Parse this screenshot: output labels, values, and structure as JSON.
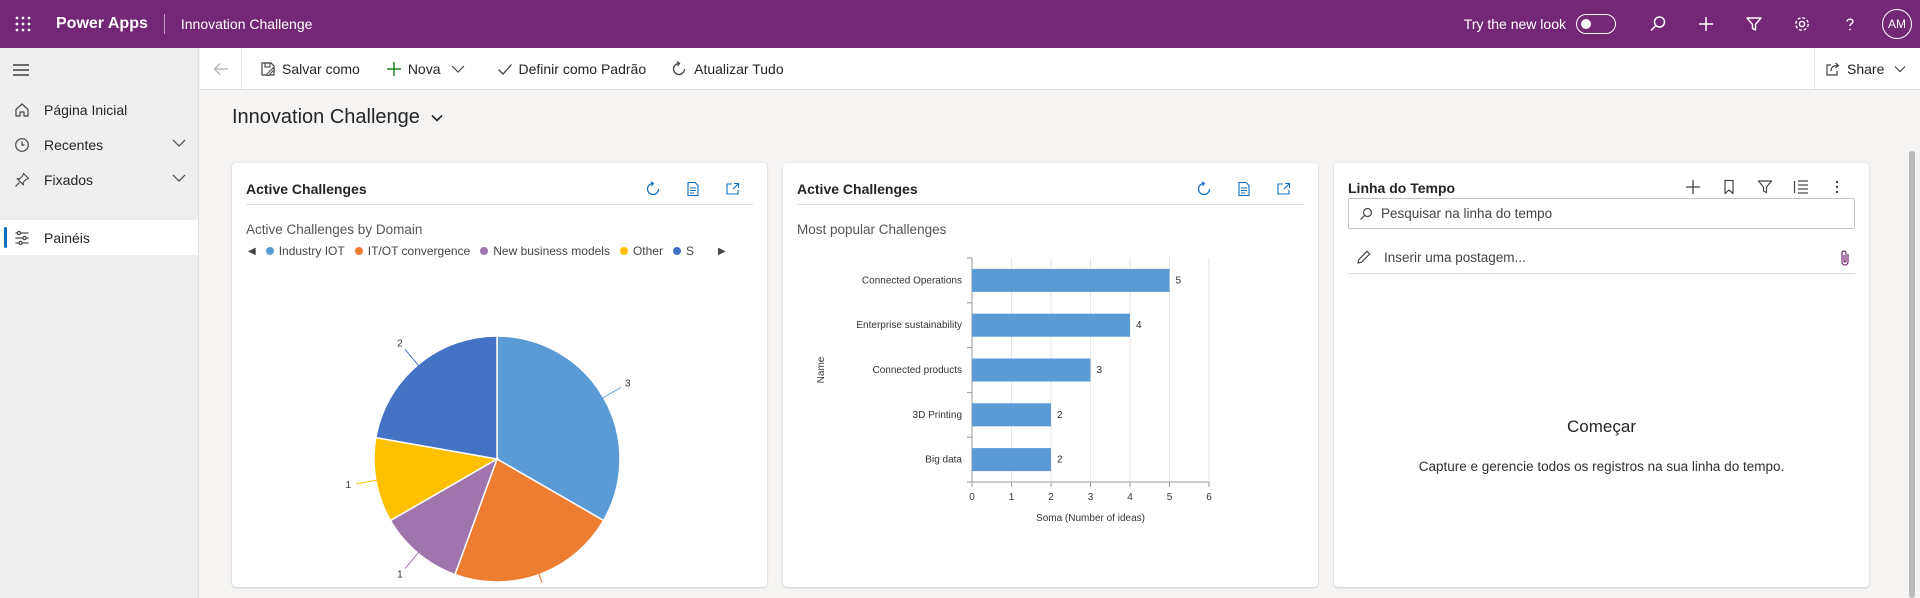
{
  "topbar": {
    "app_name": "Power Apps",
    "app_title": "Innovation Challenge",
    "try_new_look": "Try the new look",
    "avatar_initials": "AM",
    "accent_color": "#742774"
  },
  "sidebar": {
    "items": [
      {
        "label": "Página Inicial",
        "icon": "home-icon"
      },
      {
        "label": "Recentes",
        "icon": "clock-icon"
      },
      {
        "label": "Fixados",
        "icon": "pin-icon"
      },
      {
        "label": "Painéis",
        "icon": "dashboard-icon",
        "selected": true
      }
    ]
  },
  "commandbar": {
    "save_as": "Salvar como",
    "new": "Nova",
    "set_default": "Definir como Padrão",
    "refresh_all": "Atualizar Tudo",
    "share": "Share"
  },
  "dashboard": {
    "title": "Innovation Challenge"
  },
  "cards": {
    "pie": {
      "title": "Active Challenges",
      "subtitle": "Active Challenges by Domain"
    },
    "bar": {
      "title": "Active Challenges",
      "subtitle": "Most popular Challenges"
    },
    "timeline": {
      "title": "Linha do Tempo",
      "search_placeholder": "Pesquisar na linha do tempo",
      "post_placeholder": "Inserir uma postagem...",
      "empty_title": "Começar",
      "empty_text": "Capture e gerencie todos os registros na sua linha do tempo."
    }
  },
  "chart_data": [
    {
      "type": "pie",
      "subtitle": "Active Challenges by Domain",
      "legend": [
        "Industry IOT",
        "IT/OT convergence",
        "New business models",
        "Other",
        "S"
      ],
      "slices": [
        {
          "label": "Industry IOT",
          "value": 3,
          "color": "#5b9bd5"
        },
        {
          "label": "IT/OT convergence",
          "value": 2,
          "color": "#ed7d31"
        },
        {
          "label": "New business models",
          "value": 1,
          "color": "#a074ad"
        },
        {
          "label": "Other",
          "value": 1,
          "color": "#ffc000"
        },
        {
          "label": "S",
          "value": 2,
          "color": "#4472c4"
        }
      ]
    },
    {
      "type": "bar",
      "orientation": "horizontal",
      "subtitle": "Most popular Challenges",
      "categories": [
        "Connected Operations",
        "Enterprise sustainability",
        "Connected products",
        "3D Printing",
        "Big data"
      ],
      "values": [
        5,
        4,
        3,
        2,
        2
      ],
      "xlabel": "Soma (Number of ideas)",
      "ylabel": "Name",
      "xlim": [
        0,
        6
      ],
      "xticks": [
        "0",
        "1",
        "2",
        "3",
        "4",
        "5",
        "6"
      ],
      "bar_color": "#5b9bd5",
      "grid": true
    }
  ]
}
